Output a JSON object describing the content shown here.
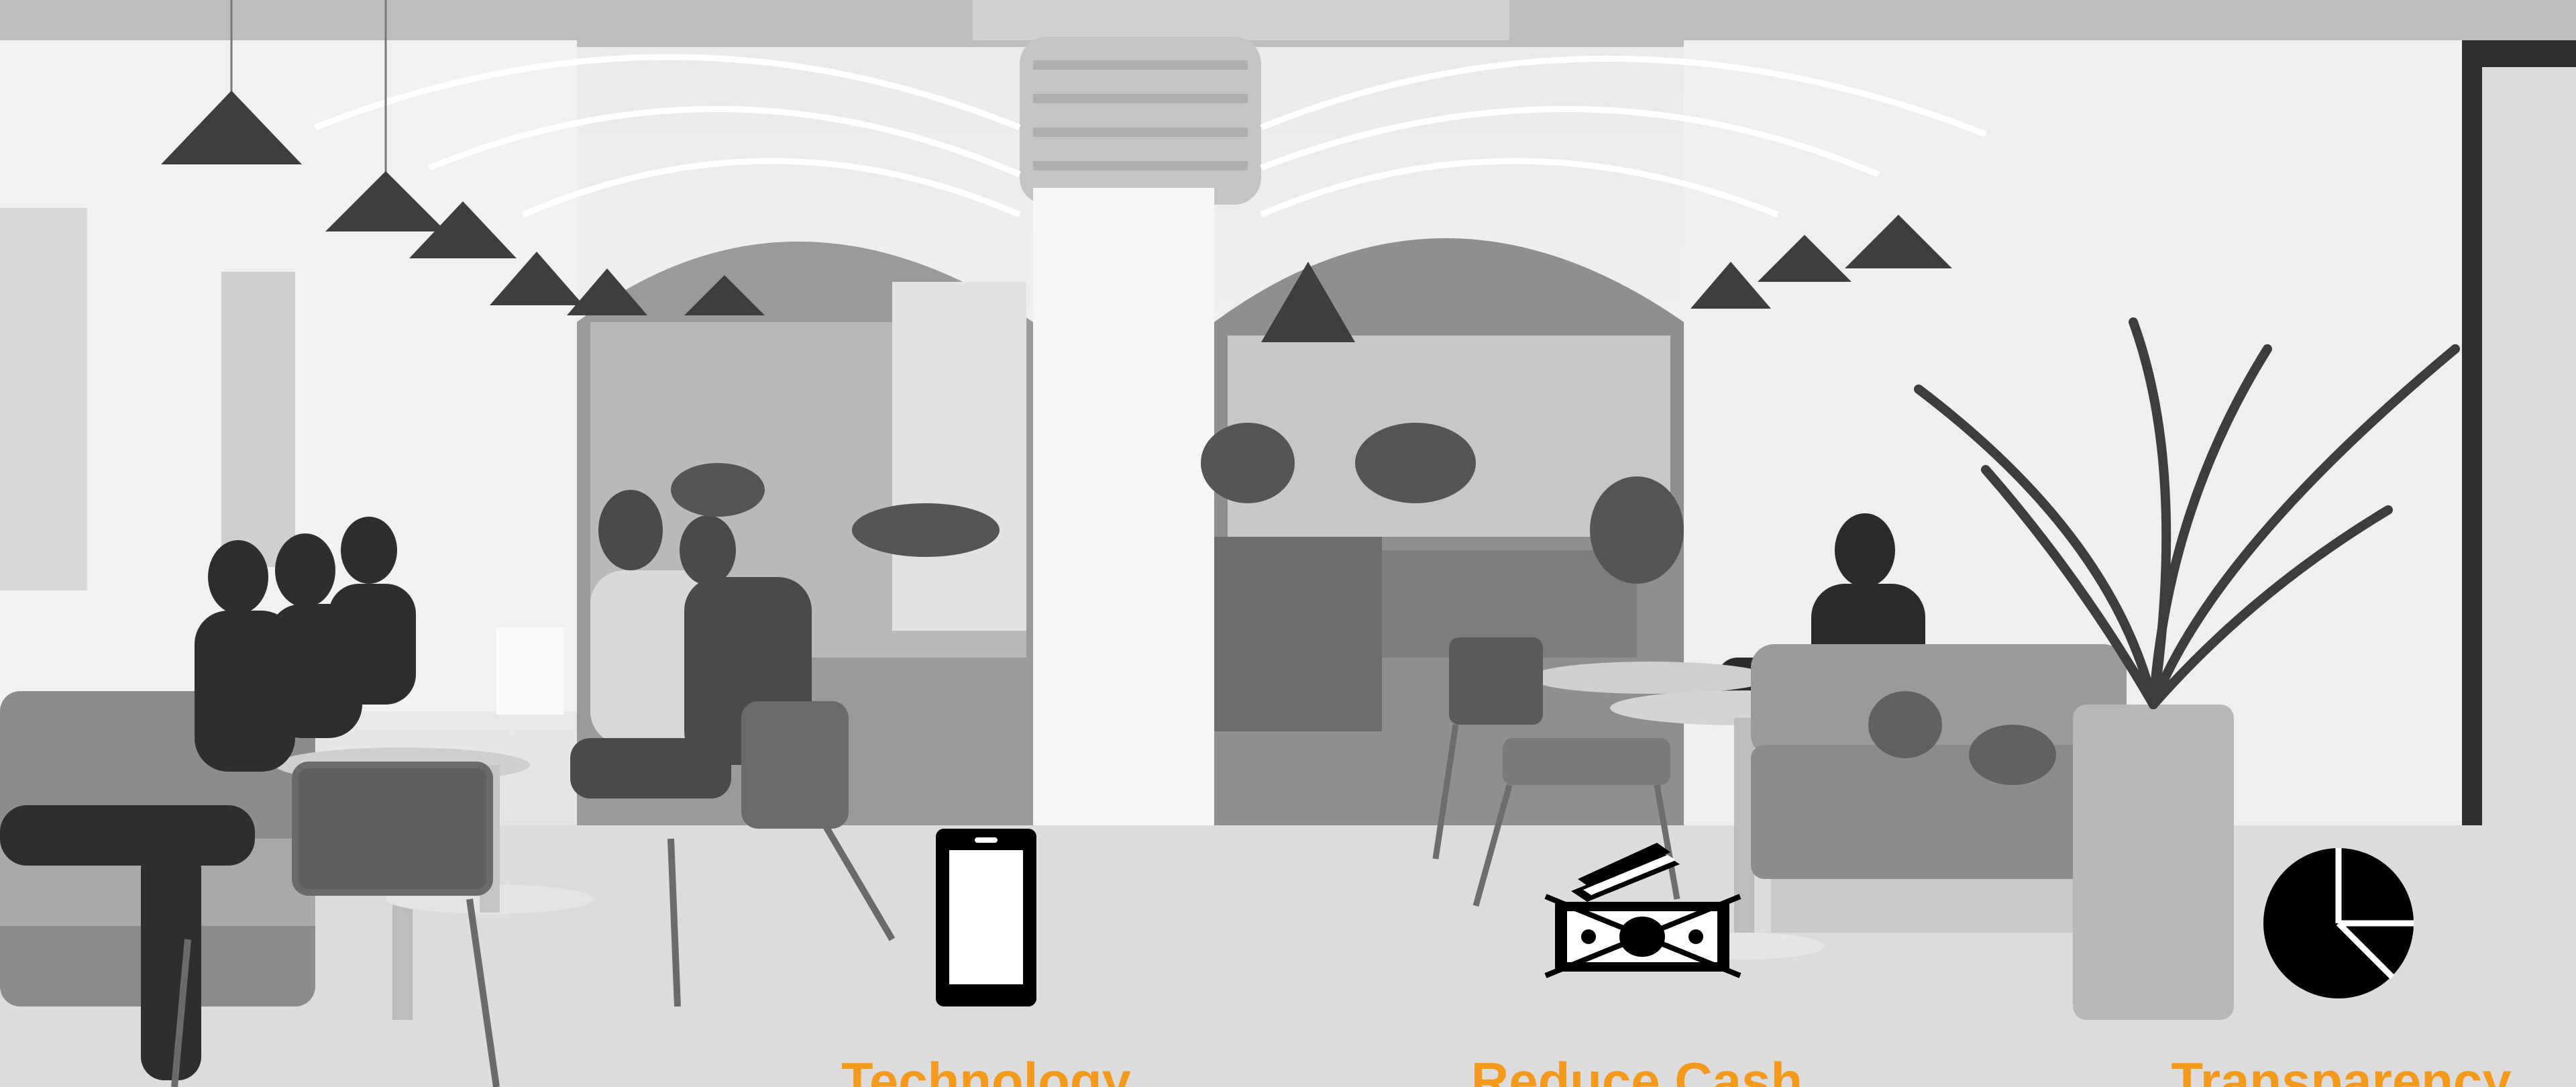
{
  "features": [
    {
      "label": "Technology",
      "icon": "smartphone-icon"
    },
    {
      "label": "Reduce Cash",
      "icon": "no-cash-icon"
    },
    {
      "label": "Transparency",
      "icon": "pie-chart-icon"
    }
  ],
  "colors": {
    "label": "#f39a1c",
    "icon": "#000000"
  }
}
